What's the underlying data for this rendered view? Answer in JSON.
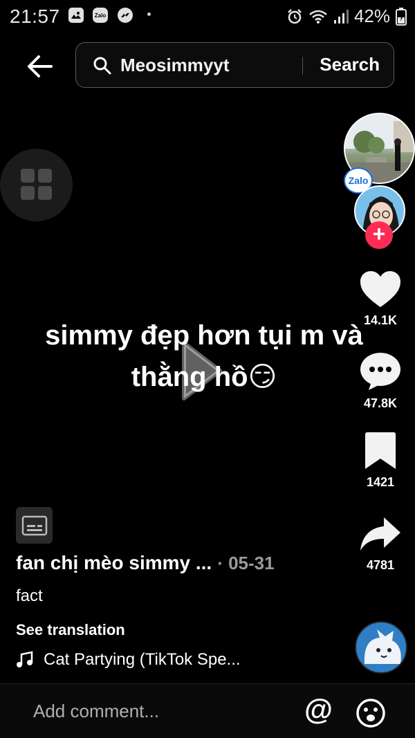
{
  "status": {
    "time": "21:57",
    "battery": "42%",
    "zalo_label": "Zalo"
  },
  "header": {
    "search_query": "Meosimmyyt",
    "search_button": "Search"
  },
  "video": {
    "caption": "simmy đẹp hơn tụi m và thằng hồ😏"
  },
  "actions": {
    "likes": "14.1K",
    "comments": "47.8K",
    "bookmarks": "1421",
    "shares": "4781"
  },
  "overlay": {
    "zalo_badge": "Zalo"
  },
  "post": {
    "author": "fan chị mèo simmy ...",
    "date": "· 05-31",
    "description": "fact",
    "see_translation": "See translation",
    "sound": "Cat Partying (TikTok Spe..."
  },
  "comment_bar": {
    "placeholder": "Add comment...",
    "mention_symbol": "@"
  },
  "colors": {
    "accent": "#fe2c55",
    "background": "#000000",
    "zalo_blue": "#1a6fe0"
  }
}
